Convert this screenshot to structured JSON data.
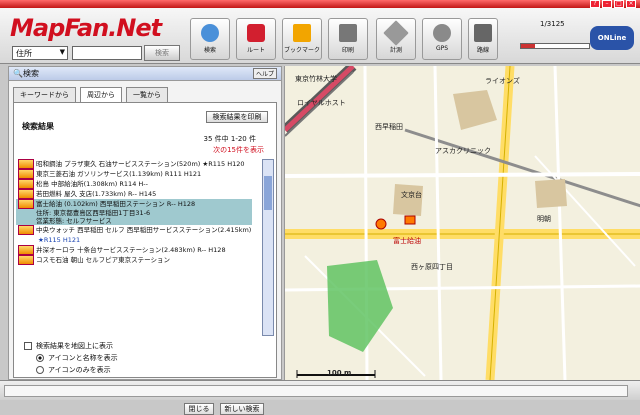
{
  "app": {
    "logo": "MapFan.Net",
    "window_controls": [
      "?",
      "–",
      "□",
      "×"
    ]
  },
  "toolbar": {
    "address_type": "住所",
    "search_button": "検索",
    "tools": [
      {
        "label": "検索",
        "icon": "search-icon"
      },
      {
        "label": "ルート",
        "icon": "car-icon"
      },
      {
        "label": "ブックマーク",
        "icon": "bookmark-icon"
      },
      {
        "label": "印刷",
        "icon": "printer-icon"
      },
      {
        "label": "計測",
        "icon": "ruler-icon"
      },
      {
        "label": "GPS",
        "icon": "gps-icon"
      },
      {
        "label": "路線",
        "icon": "route-icon"
      }
    ],
    "scale": "1/3125",
    "online": "ONLine"
  },
  "search_panel": {
    "title": "検索",
    "help": "ヘルプ",
    "tabs": [
      "キーワードから",
      "周辺から",
      "一覧から"
    ],
    "results_title": "検索結果",
    "print_results": "検索結果を印刷",
    "count": "35 件中 1-20 件",
    "next_page": "次の15件を表示",
    "items": [
      "昭和鋼油 プラザ東久 石油サービスステーション(520m) ★R115 H120",
      "東京三菱石油 ガソリンサービス(1.139km) R111 H121",
      "松島 中部給油所(1.308km) R114 H--",
      "若田燃料 屋久 支店(1.733km) R-- H145",
      "富士給油 (0.102km) 西早稲田ステーション R-- H128",
      "中央ウォッチ 西早稲田 セルフ 西早稲田サービスステーション(2.415km)",
      "★R115 H121",
      "井深オーロラ 十条台サービスステーション(2.483km) R-- H128",
      "コスモ石油 朝山 セルフピア東京ステーション"
    ],
    "selected": {
      "name": "富士給油 西早稲田ステーション",
      "address_label": "住所:",
      "address": "東京都豊島区西早稲田1丁目31-6",
      "type_label": "営業形態:",
      "type": "セルフサービス"
    },
    "show_on_map": "検索結果を地図上に表示",
    "radio_icon_name": "アイコンと名称を表示",
    "radio_icon_only": "アイコンのみを表示",
    "close_button": "閉じる",
    "new_search_button": "新しい検索"
  },
  "map": {
    "labels": [
      "東京竹林大学",
      "ロイヤルホスト",
      "西早稲田",
      "アスカクリニック",
      "ライオンズ",
      "文京台",
      "富士給油",
      "西ヶ原四丁目",
      "明朝",
      "100 m"
    ],
    "scale_text": "100 m"
  }
}
